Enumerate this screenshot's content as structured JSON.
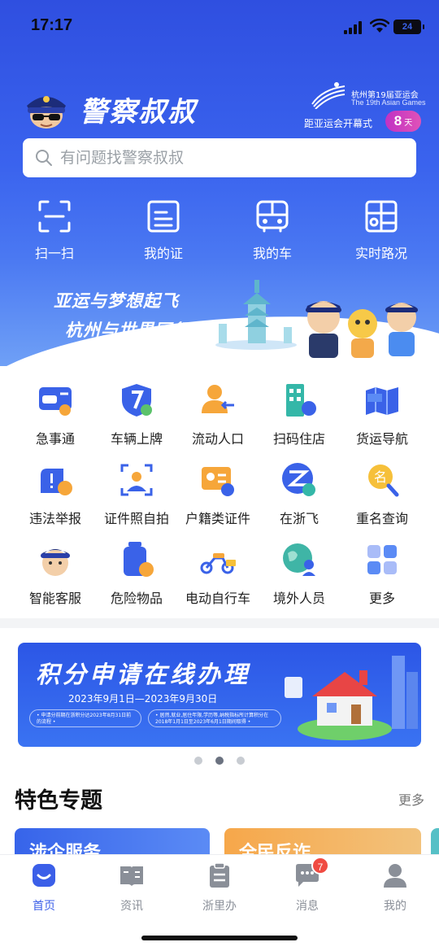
{
  "status_bar": {
    "time": "17:17",
    "battery": "24"
  },
  "header": {
    "app_title": "警察叔叔",
    "games_line1": "杭州第19届亚运会",
    "games_line2": "The 19th Asian Games",
    "countdown_label": "距亚运会开幕式",
    "countdown_value": "8",
    "countdown_unit": "天"
  },
  "search": {
    "placeholder": "有问题找警察叔叔"
  },
  "quick_actions": [
    {
      "label": "扫一扫",
      "icon": "scan-icon"
    },
    {
      "label": "我的证",
      "icon": "id-card-icon"
    },
    {
      "label": "我的车",
      "icon": "car-icon"
    },
    {
      "label": "实时路况",
      "icon": "map-icon"
    }
  ],
  "hero_banner": {
    "slogan_line1": "亚运与梦想起飞",
    "slogan_line2": "杭州与世界同行"
  },
  "services": [
    {
      "label": "急事通",
      "icon": "urgent-card-icon"
    },
    {
      "label": "车辆上牌",
      "icon": "vehicle-plate-icon"
    },
    {
      "label": "流动人口",
      "icon": "floating-population-icon"
    },
    {
      "label": "扫码住店",
      "icon": "hotel-scan-icon"
    },
    {
      "label": "货运导航",
      "icon": "freight-nav-icon"
    },
    {
      "label": "违法举报",
      "icon": "violation-report-icon"
    },
    {
      "label": "证件照自拍",
      "icon": "id-photo-icon"
    },
    {
      "label": "户籍类证件",
      "icon": "household-cert-icon"
    },
    {
      "label": "在浙飞",
      "icon": "zaizhefei-icon"
    },
    {
      "label": "重名查询",
      "icon": "name-search-icon"
    },
    {
      "label": "智能客服",
      "icon": "smart-service-icon"
    },
    {
      "label": "危险物品",
      "icon": "hazardous-goods-icon"
    },
    {
      "label": "电动自行车",
      "icon": "e-bike-icon"
    },
    {
      "label": "境外人员",
      "icon": "foreigner-icon"
    },
    {
      "label": "更多",
      "icon": "more-grid-icon"
    }
  ],
  "promo": {
    "title": "积分申请在线办理",
    "dates": "2023年9月1日—2023年9月30日",
    "note1": "• 申请分前期在浙积分达2023年8月31日前的流程 •",
    "note2": "• 居然,就业,居住年限,学历等,纳税指标所计算积分在2018年1月1日至2023年6月1日期间取得 •"
  },
  "carousel": {
    "count": 3,
    "active": 1
  },
  "featured": {
    "title": "特色专题",
    "more": "更多",
    "cards": [
      {
        "title": "涉企服务"
      },
      {
        "title": "全民反诈"
      }
    ]
  },
  "tabbar": {
    "tabs": [
      {
        "label": "首页",
        "icon": "home-icon",
        "active": true
      },
      {
        "label": "资讯",
        "icon": "news-icon",
        "active": false
      },
      {
        "label": "浙里办",
        "icon": "zheliban-icon",
        "active": false
      },
      {
        "label": "消息",
        "icon": "message-icon",
        "active": false,
        "badge": "7"
      },
      {
        "label": "我的",
        "icon": "profile-icon",
        "active": false
      }
    ]
  },
  "colors": {
    "brand_blue": "#3b5fe8",
    "badge_red": "#f04b42",
    "countdown_pink": "#d03fbf"
  }
}
